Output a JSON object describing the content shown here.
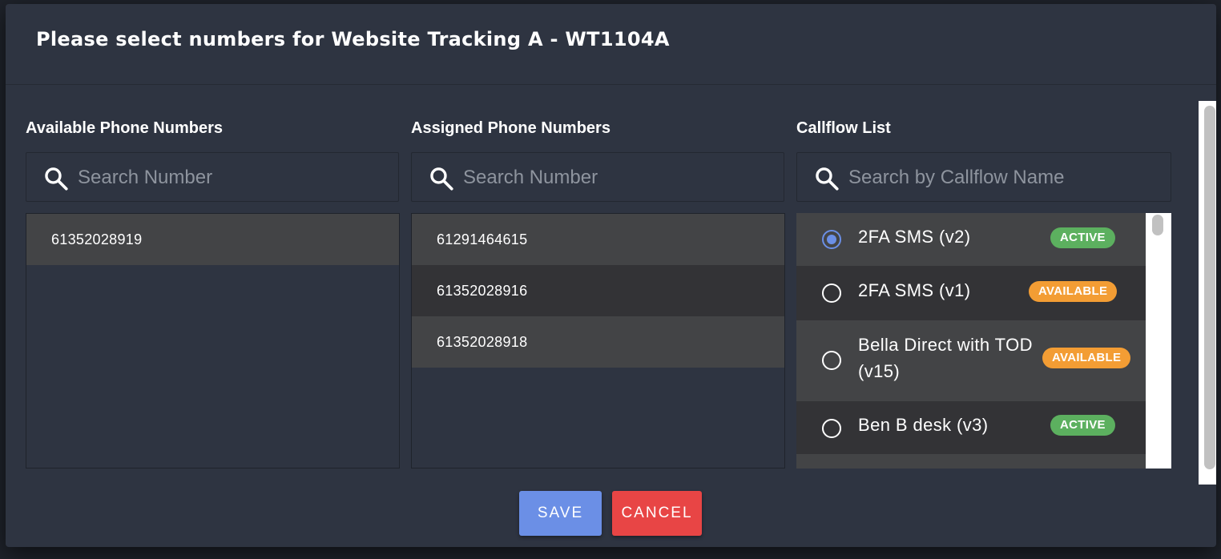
{
  "dialog": {
    "title": "Please select numbers for Website Tracking A - WT1104A"
  },
  "available": {
    "title": "Available Phone Numbers",
    "search_placeholder": "Search Number",
    "numbers": [
      "61352028919"
    ]
  },
  "assigned": {
    "title": "Assigned Phone Numbers",
    "search_placeholder": "Search Number",
    "numbers": [
      "61291464615",
      "61352028916",
      "61352028918"
    ]
  },
  "callflow": {
    "title": "Callflow List",
    "search_placeholder": "Search by Callflow Name",
    "items": [
      {
        "label": "2FA SMS (v2)",
        "status": "ACTIVE",
        "selected": true
      },
      {
        "label": "2FA SMS (v1)",
        "status": "AVAILABLE",
        "selected": false
      },
      {
        "label": "Bella Direct with TOD (v15)",
        "status": "AVAILABLE",
        "selected": false
      },
      {
        "label": "Ben B desk (v3)",
        "status": "ACTIVE",
        "selected": false
      }
    ]
  },
  "buttons": {
    "save": "SAVE",
    "cancel": "CANCEL"
  },
  "colors": {
    "dialog_bg": "#2e3441",
    "active_badge": "#5cb05f",
    "available_badge": "#f39d34",
    "save_button": "#6b8fe6",
    "cancel_button": "#e84545"
  }
}
